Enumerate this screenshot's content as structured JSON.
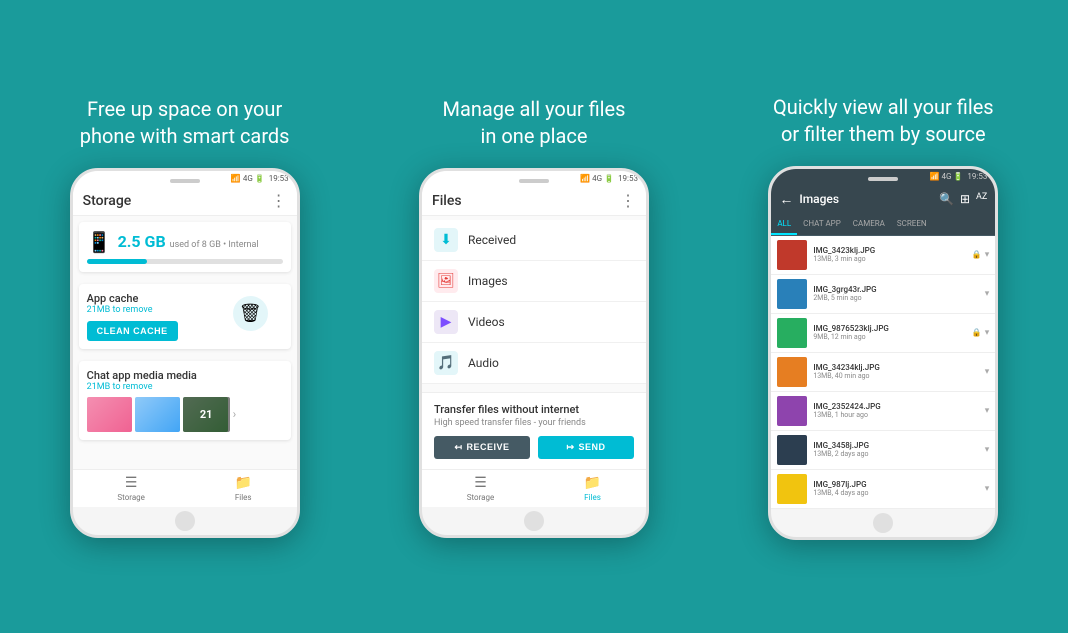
{
  "panels": [
    {
      "title": "Free up space on your\nphone with smart cards",
      "phone": {
        "statusBar": {
          "network": "4G",
          "time": "19:53"
        },
        "header": {
          "title": "Storage",
          "showDots": true
        },
        "storage": {
          "icon": "📱",
          "gb": "2.5 GB",
          "sub": "used of 8 GB • Internal",
          "barPercent": 31
        },
        "cacheCard": {
          "title": "App cache",
          "sub": "21MB to remove",
          "btnLabel": "CLEAN CACHE"
        },
        "chatMedia": {
          "title": "Chat app media media",
          "sub": "21MB to remove",
          "count": "21"
        },
        "nav": [
          {
            "label": "Storage",
            "active": false
          },
          {
            "label": "Files",
            "active": false
          }
        ]
      }
    },
    {
      "title": "Manage all your files\nin one place",
      "phone": {
        "statusBar": {
          "network": "4G",
          "time": "19:53"
        },
        "header": {
          "title": "Files",
          "showDots": true
        },
        "files": [
          {
            "label": "Received",
            "iconType": "received",
            "icon": "⬇"
          },
          {
            "label": "Images",
            "iconType": "images",
            "icon": "🖼"
          },
          {
            "label": "Videos",
            "iconType": "videos",
            "icon": "▶"
          },
          {
            "label": "Audio",
            "iconType": "audio",
            "icon": "🎵"
          }
        ],
        "transfer": {
          "title": "Transfer files without internet",
          "sub": "High speed transfer files - your friends",
          "receiveLabel": "RECEIVE",
          "sendLabel": "SEND"
        },
        "nav": [
          {
            "label": "Storage",
            "active": false
          },
          {
            "label": "Files",
            "active": true
          }
        ]
      }
    },
    {
      "title": "Quickly view all your files\nor filter them by source",
      "phone": {
        "statusBar": {
          "network": "4G",
          "time": "19:53"
        },
        "header": {
          "title": "Images",
          "back": true
        },
        "filterTabs": [
          "ALL",
          "CHAT APP",
          "CAMERA",
          "SCREEN"
        ],
        "activeTab": 0,
        "images": [
          {
            "name": "IMG_3423klj.JPG",
            "meta": "13MB, 3 min ago",
            "swatch": "swatch-red",
            "locked": true
          },
          {
            "name": "IMG_3grg43r.JPG",
            "meta": "2MB, 5 min ago",
            "swatch": "swatch-blue",
            "locked": false
          },
          {
            "name": "IMG_9876523klj.JPG",
            "meta": "9MB, 12 min ago",
            "swatch": "swatch-green",
            "locked": true
          },
          {
            "name": "IMG_34234klj.JPG",
            "meta": "13MB, 40 min ago",
            "swatch": "swatch-orange",
            "locked": false
          },
          {
            "name": "IMG_2352424.JPG",
            "meta": "13MB, 1 hour ago",
            "swatch": "swatch-purple",
            "locked": false
          },
          {
            "name": "IMG_3458j.JPG",
            "meta": "13MB, 2 days ago",
            "swatch": "swatch-dark",
            "locked": false
          },
          {
            "name": "IMG_987lj.JPG",
            "meta": "13MB, 4 days ago",
            "swatch": "swatch-yellow",
            "locked": false
          }
        ]
      }
    }
  ],
  "icons": {
    "dots": "⋮",
    "back_arrow": "←",
    "search": "🔍",
    "grid": "⊞",
    "sort": "AZ",
    "lock": "🔒",
    "chevron": "▾",
    "receive_arrow": "↤",
    "send_arrow": "↦",
    "storage_nav": "☰",
    "files_nav": "📁"
  }
}
